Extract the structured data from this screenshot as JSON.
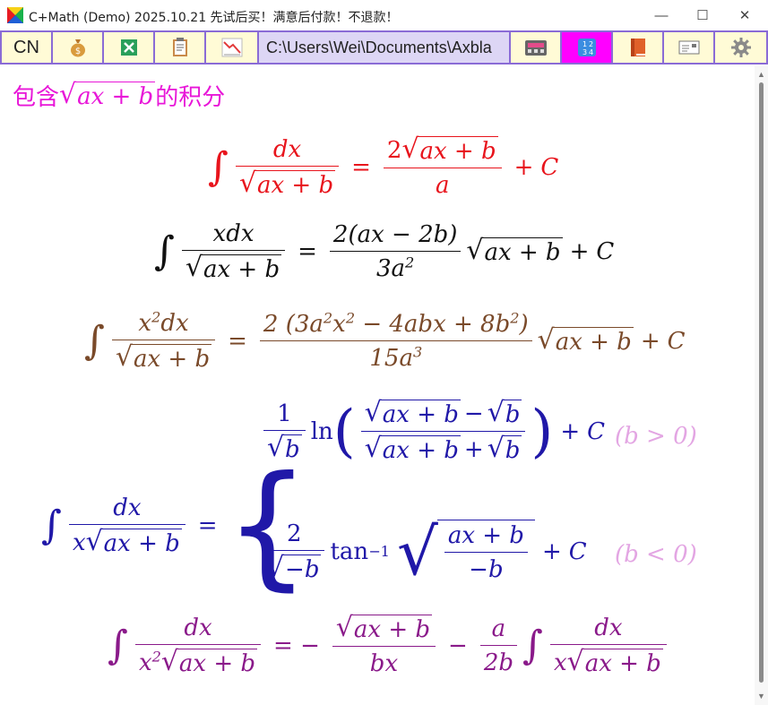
{
  "window": {
    "title": "C+Math (Demo) 2025.10.21 先试后买！满意后付款！不退款！",
    "minimize": "—",
    "maximize": "☐",
    "close": "✕"
  },
  "toolbar": {
    "lang": "CN",
    "path": "C:\\Users\\Wei\\Documents\\Axbla",
    "icons": [
      "money-bag-icon",
      "excel-icon",
      "clipboard-icon",
      "chart-down-icon",
      "calculator-icon",
      "numbers-icon",
      "book-icon",
      "id-card-icon",
      "gear-icon"
    ],
    "active_color": "#ff00ff"
  },
  "heading": {
    "prefix": "包含",
    "expr": "ax + b",
    "suffix": "的积分",
    "color": "#e816d8"
  },
  "formulas": {
    "f1": {
      "color": "#e8141c",
      "dx": "dx",
      "rad": "ax + b",
      "num2": "2",
      "rad2": "ax + b",
      "den2": "a",
      "eq": "=",
      "plus": "+",
      "C": "C"
    },
    "f2": {
      "color": "#111111",
      "num": "xdx",
      "rad": "ax + b",
      "num2": "2(ax − 2b)",
      "den2": "3a",
      "den2sup": "2",
      "rad2": "ax + b",
      "plus": "+",
      "C": "C",
      "eq": "="
    },
    "f3": {
      "color": "#7a4a2a",
      "num": "x",
      "numsup": "2",
      "numtail": "dx",
      "rad": "ax + b",
      "num2a": "2 (3a",
      "s1": "2",
      "num2b": "x",
      "s2": "2",
      "num2c": " − 4abx + 8b",
      "s3": "2",
      "num2d": ")",
      "den2": "15a",
      "den2sup": "3",
      "rad2": "ax + b",
      "plus": "+",
      "C": "C",
      "eq": "="
    },
    "f4": {
      "color": "#2018a8",
      "num": "dx",
      "denx": "x",
      "rad": "ax + b",
      "eq": "=",
      "c1": {
        "one": "1",
        "radb": "b",
        "ln": "ln",
        "lpar": "(",
        "rad1": "ax + b",
        "minus": "−",
        "radb2": "b",
        "rad3": "ax + b",
        "plus": "+",
        "radb3": "b",
        "rpar": ")",
        "plusC": "+",
        "C": "C",
        "cond": "(b > 0)"
      },
      "c2": {
        "two": "2",
        "radmb": "−b",
        "tan": "tan",
        "inv": "−1",
        "radnum": "ax + b",
        "radden": "−b",
        "plus": "+",
        "C": "C",
        "cond": "(b < 0)"
      }
    },
    "f5": {
      "color": "#8a1a8a",
      "num": "dx",
      "denx": "x",
      "denxsup": "2",
      "rad": "ax + b",
      "eq": "= −",
      "num2rad": "ax + b",
      "den2": "bx",
      "minus": "−",
      "num3": "a",
      "den3": "2b",
      "num4": "dx",
      "den4x": "x",
      "rad4": "ax + b"
    }
  }
}
